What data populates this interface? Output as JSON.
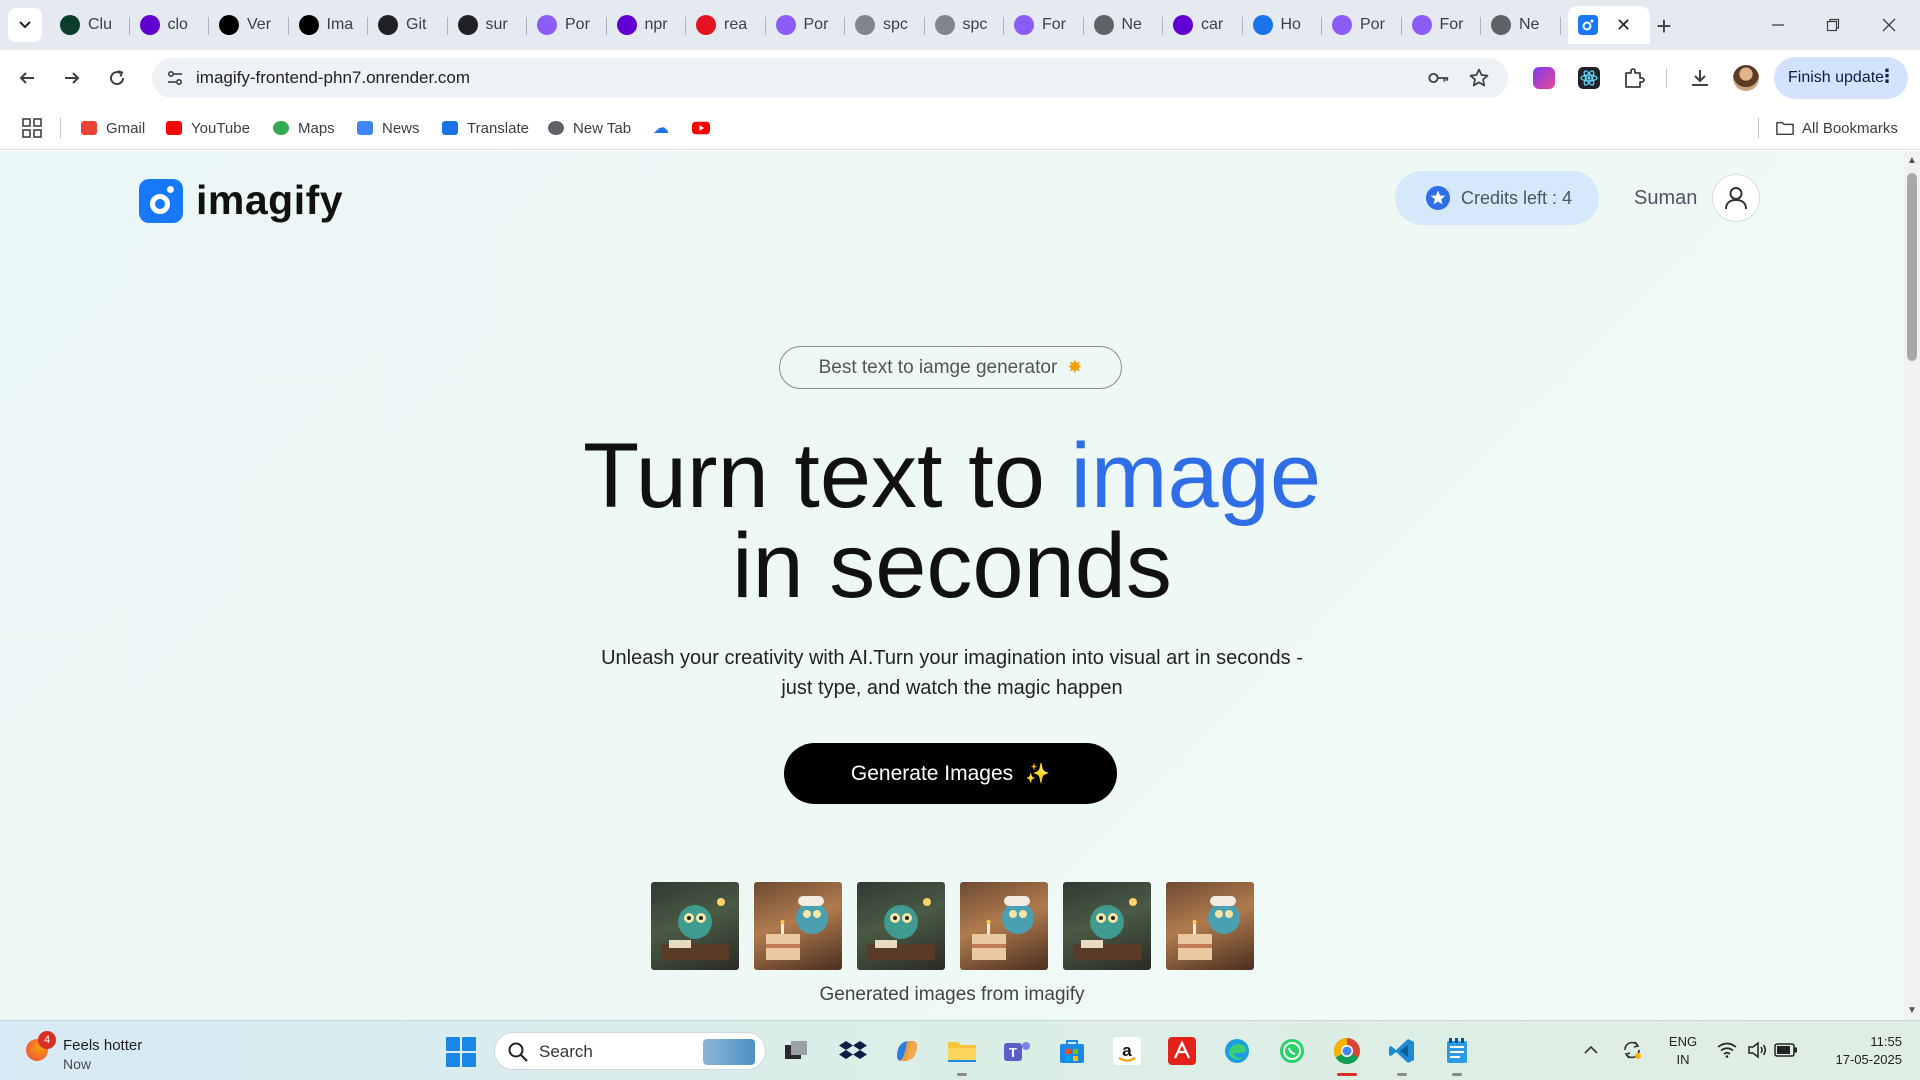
{
  "browser": {
    "tabs": [
      {
        "label": "Clu",
        "icon": "mongodb-icon",
        "color": "#0b3d2e"
      },
      {
        "label": "clo",
        "icon": "yahoo-icon",
        "color": "#6001d2"
      },
      {
        "label": "Ver",
        "icon": "vercel-icon",
        "color": "#000000"
      },
      {
        "label": "Ima",
        "icon": "link-icon",
        "color": "#000000"
      },
      {
        "label": "Git",
        "icon": "openai-icon",
        "color": "#202124"
      },
      {
        "label": "sur",
        "icon": "github-icon",
        "color": "#202124"
      },
      {
        "label": "Por",
        "icon": "vite-icon",
        "color": "#8b5cf6"
      },
      {
        "label": "npr",
        "icon": "yahoo-icon",
        "color": "#6001d2"
      },
      {
        "label": "rea",
        "icon": "redbubble-icon",
        "color": "#e41321"
      },
      {
        "label": "Por",
        "icon": "vite-icon",
        "color": "#8b5cf6"
      },
      {
        "label": "spc",
        "icon": "globe-icon",
        "color": "#80868b"
      },
      {
        "label": "spc",
        "icon": "globe-icon",
        "color": "#80868b"
      },
      {
        "label": "For",
        "icon": "vite-icon",
        "color": "#8b5cf6"
      },
      {
        "label": "Ne",
        "icon": "globe-icon",
        "color": "#5f6368"
      },
      {
        "label": "car",
        "icon": "yahoo-icon",
        "color": "#6001d2"
      },
      {
        "label": "Ho",
        "icon": "canva-icon",
        "color": "#1a73e8"
      },
      {
        "label": "Por",
        "icon": "vite-icon",
        "color": "#8b5cf6"
      },
      {
        "label": "For",
        "icon": "vite-icon",
        "color": "#8b5cf6"
      },
      {
        "label": "Ne",
        "icon": "globe-icon",
        "color": "#5f6368"
      }
    ],
    "active_tab_icon": "imagify-icon",
    "close_glyph": "✕",
    "new_tab_glyph": "+",
    "url": "imagify-frontend-phn7.onrender.com",
    "finish_update": "Finish update",
    "bookmarks": [
      {
        "label": "Gmail",
        "icon": "gmail-icon"
      },
      {
        "label": "YouTube",
        "icon": "youtube-icon"
      },
      {
        "label": "Maps",
        "icon": "maps-icon"
      },
      {
        "label": "News",
        "icon": "news-icon"
      },
      {
        "label": "Translate",
        "icon": "translate-icon"
      },
      {
        "label": "New Tab",
        "icon": "globe-icon"
      }
    ],
    "all_bookmarks": "All Bookmarks"
  },
  "app": {
    "brand": "imagify",
    "credits_label": "Credits left : 4",
    "username": "Suman",
    "badge_text": "Best text to iamge generator",
    "hero_part1": "Turn text to ",
    "hero_accent": "image",
    "hero_line2": "in seconds",
    "subtitle_line1": "Unleash your creativity with AI.Turn your imagination into visual art in seconds -",
    "subtitle_line2": "just type, and watch the magic happen",
    "cta_label": "Generate Images",
    "cta_glyph": "✨",
    "gallery_caption": "Generated images from imagify",
    "accent_color": "#2f6ee6"
  },
  "taskbar": {
    "weather_title": "Feels hotter",
    "weather_sub": "Now",
    "weather_badge": "4",
    "search_placeholder": "Search",
    "lang_line1": "ENG",
    "lang_line2": "IN",
    "time": "11:55",
    "date": "17-05-2025"
  }
}
